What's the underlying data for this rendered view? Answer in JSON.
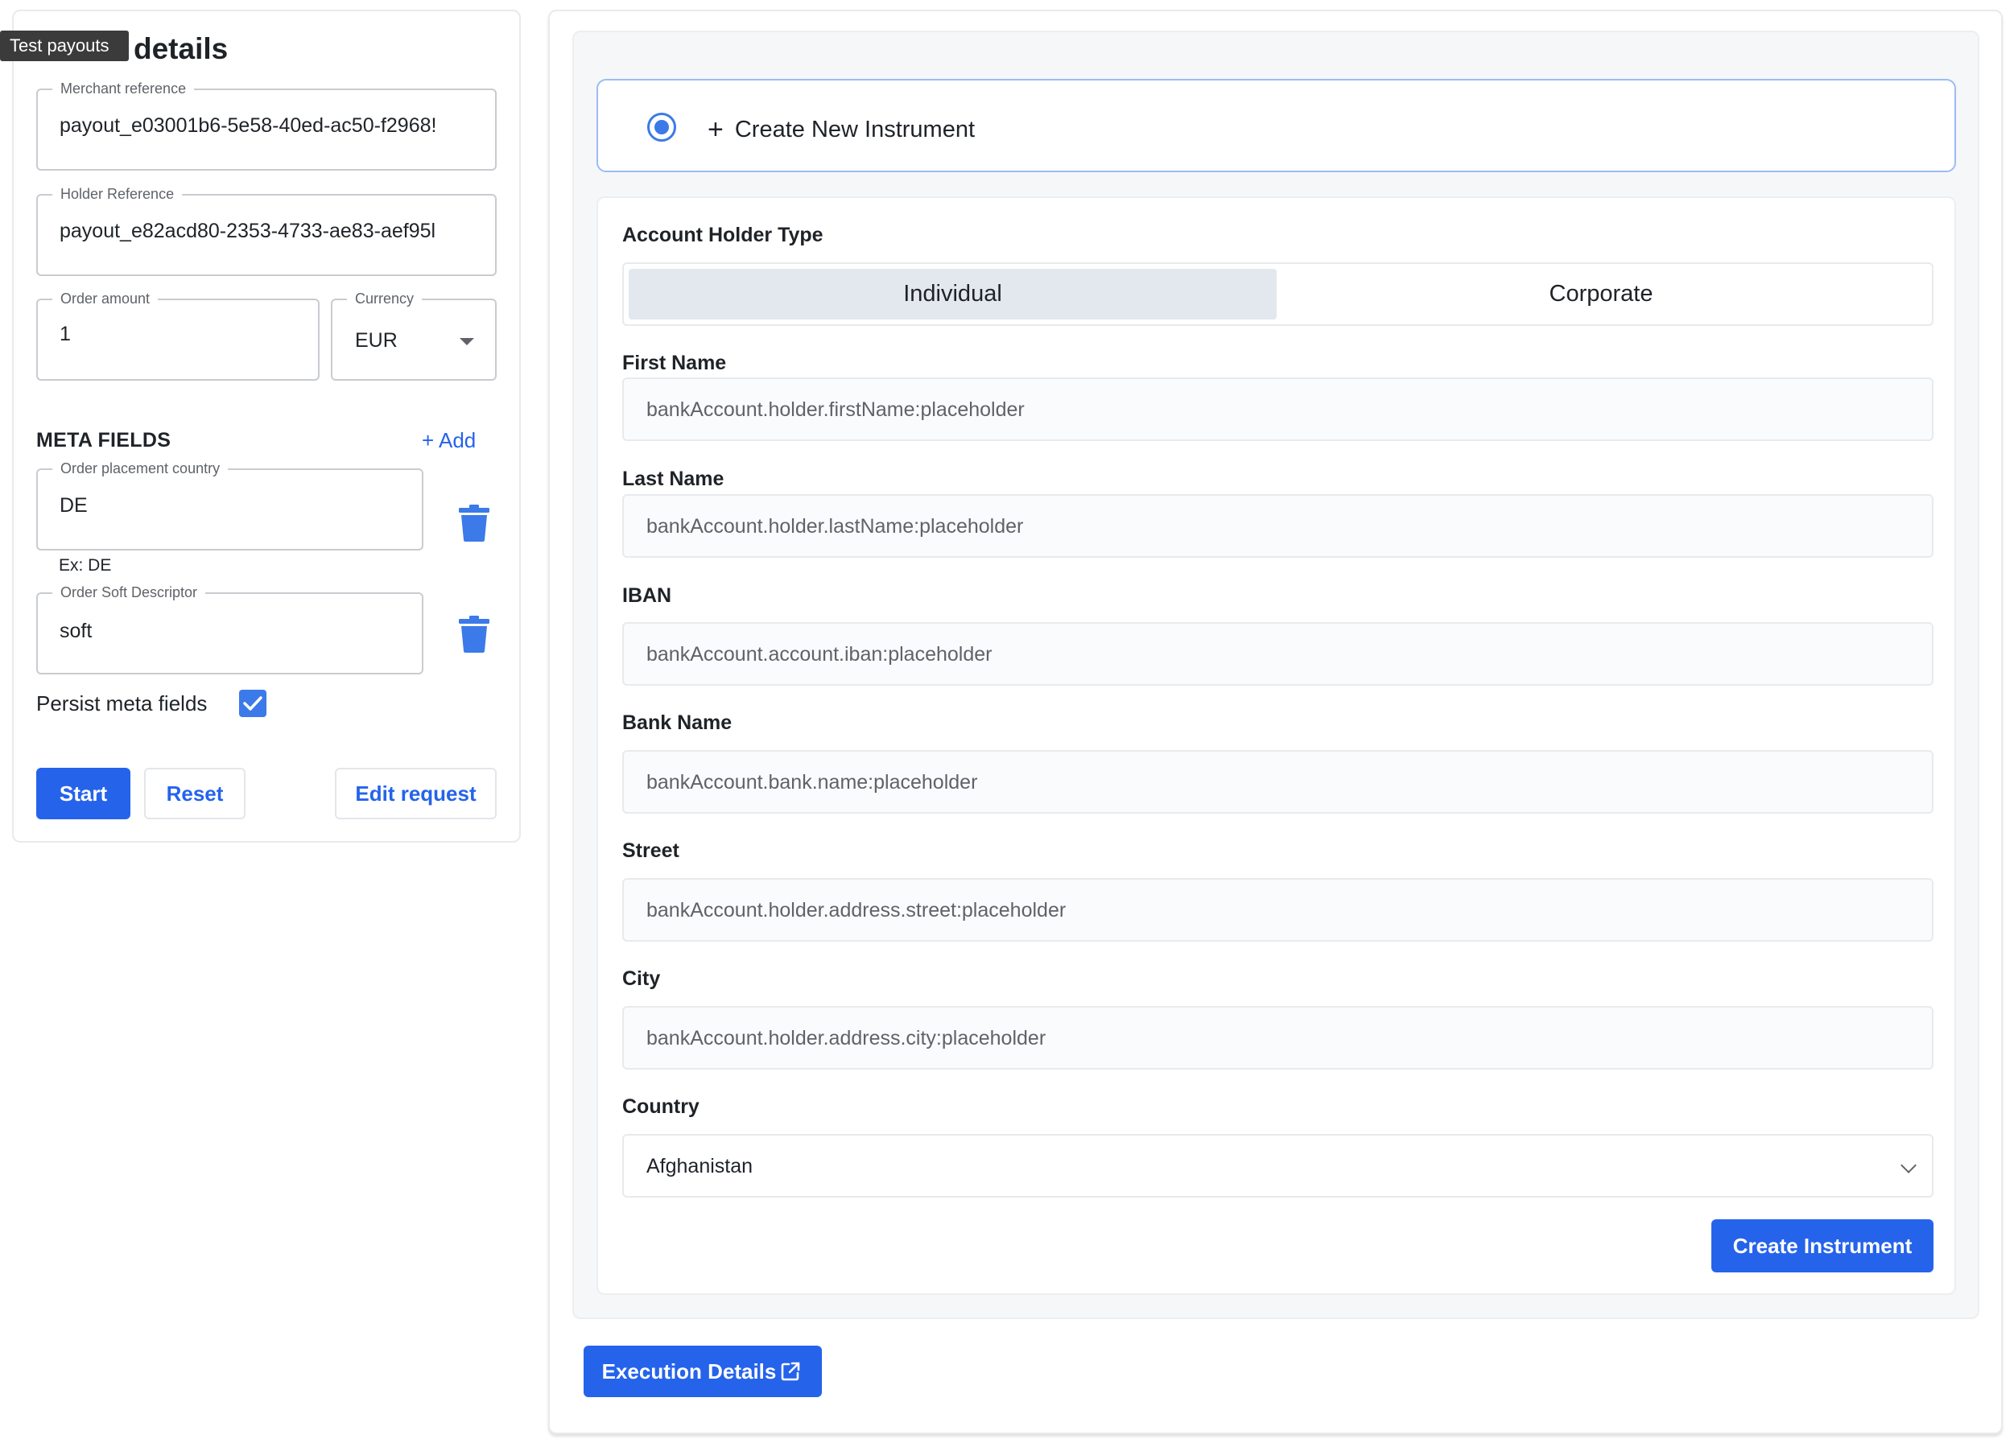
{
  "tooltip": "Test payouts",
  "left_panel": {
    "title": "details",
    "merchant_reference": {
      "label": "Merchant reference",
      "value": "payout_e03001b6-5e58-40ed-ac50-f2968!"
    },
    "holder_reference": {
      "label": "Holder Reference",
      "value": "payout_e82acd80-2353-4733-ae83-aef95l"
    },
    "order_amount": {
      "label": "Order amount",
      "value": "1"
    },
    "currency": {
      "label": "Currency",
      "value": "EUR"
    },
    "meta_fields": {
      "heading": "META FIELDS",
      "add_label": "+ Add",
      "items": [
        {
          "label": "Order placement country",
          "value": "DE",
          "helper": "Ex: DE"
        },
        {
          "label": "Order Soft Descriptor",
          "value": "soft"
        }
      ]
    },
    "persist_label": "Persist meta fields",
    "persist_checked": true,
    "buttons": {
      "start": "Start",
      "reset": "Reset",
      "edit": "Edit request"
    }
  },
  "instrument": {
    "create_new_label": "Create New Instrument",
    "account_holder_type_label": "Account Holder Type",
    "holder_types": [
      "Individual",
      "Corporate"
    ],
    "selected_holder_type": "Individual",
    "fields": [
      {
        "label": "First Name",
        "placeholder": "bankAccount.holder.firstName:placeholder"
      },
      {
        "label": "Last Name",
        "placeholder": "bankAccount.holder.lastName:placeholder"
      },
      {
        "label": "IBAN",
        "placeholder": "bankAccount.account.iban:placeholder"
      },
      {
        "label": "Bank Name",
        "placeholder": "bankAccount.bank.name:placeholder"
      },
      {
        "label": "Street",
        "placeholder": "bankAccount.holder.address.street:placeholder"
      },
      {
        "label": "City",
        "placeholder": "bankAccount.holder.address.city:placeholder"
      }
    ],
    "country": {
      "label": "Country",
      "value": "Afghanistan"
    },
    "create_button": "Create Instrument"
  },
  "execution_details_button": "Execution Details",
  "colors": {
    "primary": "#2563eb",
    "accent_radio": "#3b7ae8",
    "border": "#e8eaed"
  },
  "icons": {
    "trash": "trash-icon",
    "checkmark": "checkmark-icon",
    "external_link": "external-link-icon",
    "plus": "plus-icon",
    "dropdown": "chevron-down-icon"
  }
}
